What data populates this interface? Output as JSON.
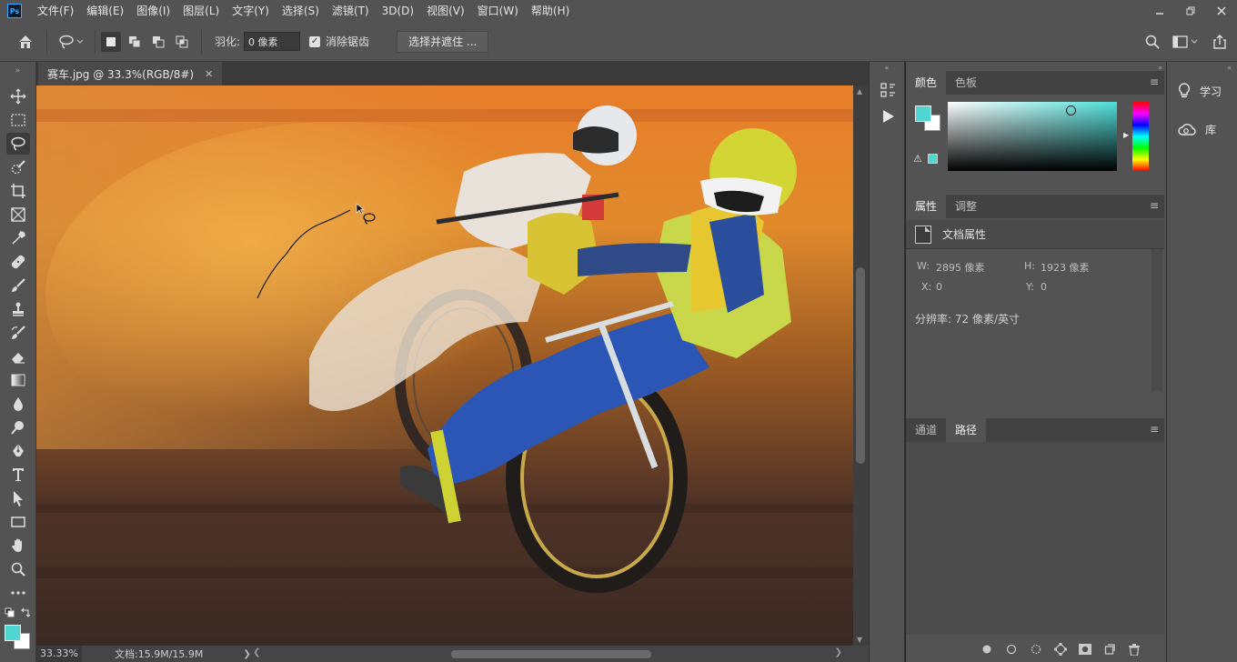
{
  "app": {
    "logo": "Ps",
    "menu": [
      "文件(F)",
      "编辑(E)",
      "图像(I)",
      "图层(L)",
      "文字(Y)",
      "选择(S)",
      "滤镜(T)",
      "3D(D)",
      "视图(V)",
      "窗口(W)",
      "帮助(H)"
    ],
    "window_controls": [
      "minimize-icon",
      "restore-icon",
      "close-icon"
    ]
  },
  "options": {
    "tool_icon": "lasso-icon",
    "feather_label": "羽化:",
    "feather_value": "0 像素",
    "antialias_checked": true,
    "antialias_label": "消除锯齿",
    "select_mask_label": "选择并遮住 ..."
  },
  "toolbar": {
    "tools": [
      "move-icon",
      "rect-marquee-icon",
      "lasso-icon",
      "quick-select-icon",
      "crop-icon",
      "frame-icon",
      "eyedropper-icon",
      "healing-brush-icon",
      "brush-icon",
      "clone-stamp-icon",
      "history-brush-icon",
      "eraser-icon",
      "gradient-icon",
      "blur-icon",
      "dodge-icon",
      "pen-icon",
      "type-icon",
      "path-select-icon",
      "rectangle-icon",
      "hand-icon",
      "zoom-icon",
      "more-tools-icon"
    ],
    "active_tool": "lasso-icon",
    "foreground_color": "#4fd6d3",
    "background_color": "#ffffff"
  },
  "document": {
    "tab_title": "赛车.jpg @ 33.3%(RGB/8#)",
    "zoom": "33.33%",
    "doc_size": "文档:15.9M/15.9M"
  },
  "color_panel": {
    "tabs": [
      "颜色",
      "色板"
    ],
    "active_tab": "颜色",
    "current_color": "#4fd6d3"
  },
  "properties_panel": {
    "tabs": [
      "属性",
      "调整"
    ],
    "active_tab": "属性",
    "section_title": "文档属性",
    "width_label": "W:",
    "width_value": "2895 像素",
    "height_label": "H:",
    "height_value": "1923 像素",
    "x_label": "X:",
    "x_value": "0",
    "y_label": "Y:",
    "y_value": "0",
    "resolution": "分辨率: 72 像素/英寸"
  },
  "paths_panel": {
    "tabs": [
      "通道",
      "路径"
    ],
    "active_tab": "路径",
    "footer_buttons": [
      "fill-path-icon",
      "stroke-path-icon",
      "load-selection-icon",
      "make-path-icon",
      "add-mask-icon",
      "new-path-icon",
      "delete-icon"
    ]
  },
  "right_dock": {
    "items": [
      {
        "icon": "lightbulb-icon",
        "label": "学习"
      },
      {
        "icon": "creative-cloud-icon",
        "label": "库"
      }
    ]
  }
}
